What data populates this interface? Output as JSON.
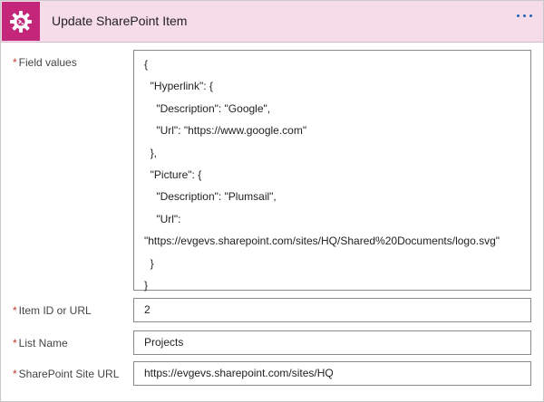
{
  "header": {
    "title": "Update SharePoint Item",
    "icon": "gear-terminal-icon",
    "more_icon": "more-options-icon",
    "accent_color": "#c4267a"
  },
  "fields": {
    "required_mark": "*",
    "field_values": {
      "label": "Field values",
      "lines": [
        "{",
        "  \"Hyperlink\": {",
        "    \"Description\": \"Google\",",
        "    \"Url\": \"https://www.google.com\"",
        "  },",
        "  \"Picture\": {",
        "    \"Description\": \"Plumsail\",",
        "    \"Url\":",
        "\"https://evgevs.sharepoint.com/sites/HQ/Shared%20Documents/logo.svg\"",
        "  }",
        "}"
      ]
    },
    "item_id": {
      "label": "Item ID or URL",
      "value": "2"
    },
    "list_name": {
      "label": "List Name",
      "value": "Projects"
    },
    "site_url": {
      "label": "SharePoint Site URL",
      "value": "https://evgevs.sharepoint.com/sites/HQ"
    }
  }
}
